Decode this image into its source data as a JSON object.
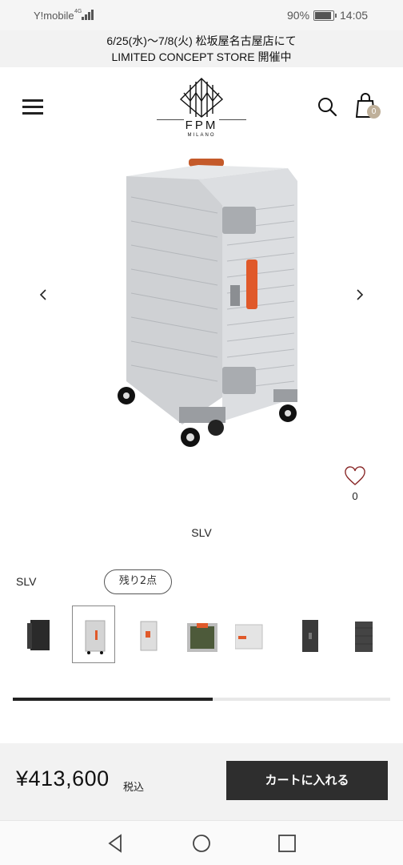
{
  "status_bar": {
    "carrier": "Y!mobile",
    "network": "4G",
    "battery_percent": "90%",
    "battery_level": 0.9,
    "time": "14:05"
  },
  "announcement": {
    "line1": "6/25(水)〜7/8(火) 松坂屋名古屋店にて",
    "line2": "LIMITED CONCEPT STORE 開催中"
  },
  "header": {
    "logo_text": "FPM",
    "logo_sub": "MILANO",
    "menu_icon": "hamburger-menu-icon",
    "search_icon": "search-icon",
    "cart_icon": "shopping-bag-icon",
    "cart_count": "0"
  },
  "gallery": {
    "prev_icon": "chevron-left-icon",
    "next_icon": "chevron-right-icon",
    "favorite_icon": "heart-icon",
    "favorite_count": "0",
    "color_caption": "SLV"
  },
  "variant": {
    "label": "SLV",
    "stock_badge": "残り2点"
  },
  "thumbnails": [
    {
      "name": "thumb-black-front",
      "color": "#2a2a2a"
    },
    {
      "name": "thumb-silver-front",
      "color": "#cfcfcf"
    },
    {
      "name": "thumb-silver-side",
      "color": "#d8d8d8"
    },
    {
      "name": "thumb-silver-open",
      "color": "#bdbdbd"
    },
    {
      "name": "thumb-silver-lying",
      "color": "#e0e0e0"
    },
    {
      "name": "thumb-dark-front",
      "color": "#3a3a3a"
    },
    {
      "name": "thumb-dark-back",
      "color": "#444444"
    }
  ],
  "carousel_progress": 0.53,
  "purchase": {
    "price": "¥413,600",
    "tax_label": "税込",
    "add_to_cart": "カートに入れる"
  },
  "nav_bar": {
    "back_icon": "back-triangle-icon",
    "home_icon": "home-circle-icon",
    "recents_icon": "recents-square-icon"
  },
  "colors": {
    "accent_orange": "#e0592a",
    "button_dark": "#2e2e2e",
    "badge_beige": "#bfb09a"
  }
}
